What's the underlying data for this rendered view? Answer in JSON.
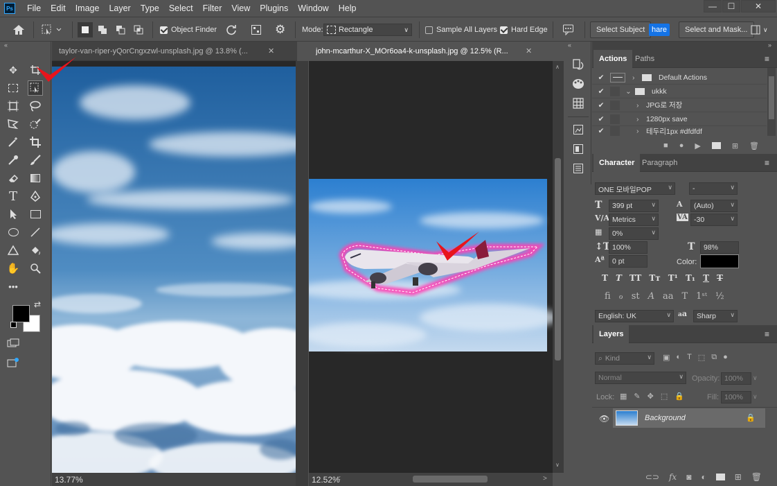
{
  "app": {
    "logo": "Ps"
  },
  "menu": [
    "File",
    "Edit",
    "Image",
    "Layer",
    "Type",
    "Select",
    "Filter",
    "View",
    "Plugins",
    "Window",
    "Help"
  ],
  "options": {
    "object_finder": "Object Finder",
    "mode_label": "Mode:",
    "mode_value": "Rectangle",
    "sample_all": "Sample All Layers",
    "hard_edge": "Hard Edge",
    "select_subject": "Select Subject",
    "share": "hare",
    "select_mask": "Select and Mask..."
  },
  "docs": [
    {
      "title": "taylor-van-riper-yQorCngxzwl-unsplash.jpg @ 13.8% (...",
      "zoom": "13.77%"
    },
    {
      "title": "john-mcarthur-X_MOr6oa4-k-unsplash.jpg @ 12.5% (R...",
      "zoom": "12.52%"
    }
  ],
  "actions_panel": {
    "tabs": [
      "Actions",
      "Paths"
    ],
    "rows": [
      {
        "label": "Default Actions",
        "type": "folder",
        "indent": 0
      },
      {
        "label": "ukkk",
        "type": "folder",
        "indent": 0
      },
      {
        "label": "JPG로 저장",
        "type": "action",
        "indent": 1
      },
      {
        "label": "1280px save",
        "type": "action",
        "indent": 1
      },
      {
        "label": "테두리1px #dfdfdf",
        "type": "action",
        "indent": 1
      }
    ]
  },
  "character_panel": {
    "tabs": [
      "Character",
      "Paragraph"
    ],
    "font_family": "ONE 모바일POP",
    "font_style": "-",
    "size": "399 pt",
    "leading": "(Auto)",
    "kerning": "Metrics",
    "tracking": "-30",
    "tsume": "0%",
    "vscale": "100%",
    "hscale": "98%",
    "baseline": "0 pt",
    "color_label": "Color:",
    "color": "#000000",
    "language": "English: UK",
    "aa_label": "a",
    "aa": "Sharp"
  },
  "layers_panel": {
    "tab": "Layers",
    "filter": "Kind",
    "blend": "Normal",
    "opacity_label": "Opacity:",
    "opacity": "100%",
    "lock_label": "Lock:",
    "fill_label": "Fill:",
    "fill": "100%",
    "layer_name": "Background"
  }
}
